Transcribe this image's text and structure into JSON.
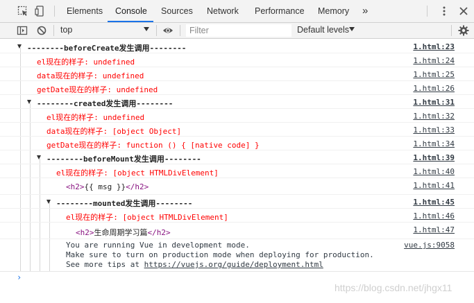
{
  "tabs": [
    {
      "label": "Elements"
    },
    {
      "label": "Console"
    },
    {
      "label": "Sources"
    },
    {
      "label": "Network"
    },
    {
      "label": "Performance"
    },
    {
      "label": "Memory"
    }
  ],
  "tabs_more": "»",
  "toolbar": {
    "context": "top",
    "filter_placeholder": "Filter",
    "levels": "Default levels"
  },
  "logs": [
    {
      "text": "--------beforeCreate发生调用--------",
      "src": "1.html:23"
    },
    {
      "label": "el现在的样子:",
      "value": "undefined",
      "src": "1.html:24"
    },
    {
      "label": "data现在的样子:",
      "value": "undefined",
      "src": "1.html:25"
    },
    {
      "label": "getDate现在的样子:",
      "value": "undefined",
      "src": "1.html:26"
    },
    {
      "text": "--------created发生调用--------",
      "src": "1.html:31"
    },
    {
      "label": "el现在的样子:",
      "value": "undefined",
      "src": "1.html:32"
    },
    {
      "label": "data现在的样子:",
      "value": "[object Object]",
      "src": "1.html:33"
    },
    {
      "label": "getDate现在的样子:",
      "value": "function () { [native code] }",
      "src": "1.html:34"
    },
    {
      "text": "--------beforeMount发生调用--------",
      "src": "1.html:39"
    },
    {
      "label": "el现在的样子:",
      "value": "[object HTMLDivElement]",
      "src": "1.html:40"
    },
    {
      "open": "<h2>",
      "content": "{{ msg }}",
      "close": "</h2>",
      "src": "1.html:41"
    },
    {
      "text": "--------mounted发生调用--------",
      "src": "1.html:45"
    },
    {
      "label": "el现在的样子:",
      "value": "[object HTMLDivElement]",
      "src": "1.html:46"
    },
    {
      "open": "<h2>",
      "content": "生命周期学习篇",
      "close": "</h2>",
      "src": "1.html:47"
    }
  ],
  "vue_info": {
    "line1": "You are running Vue in development mode.",
    "line2": "Make sure to turn on production mode when deploying for production.",
    "line3_prefix": "See more tips at ",
    "link": "https://vuejs.org/guide/deployment.html",
    "src": "vue.js:9058"
  },
  "prompt": "›",
  "watermark": "https://blog.csdn.net/jhgx11"
}
